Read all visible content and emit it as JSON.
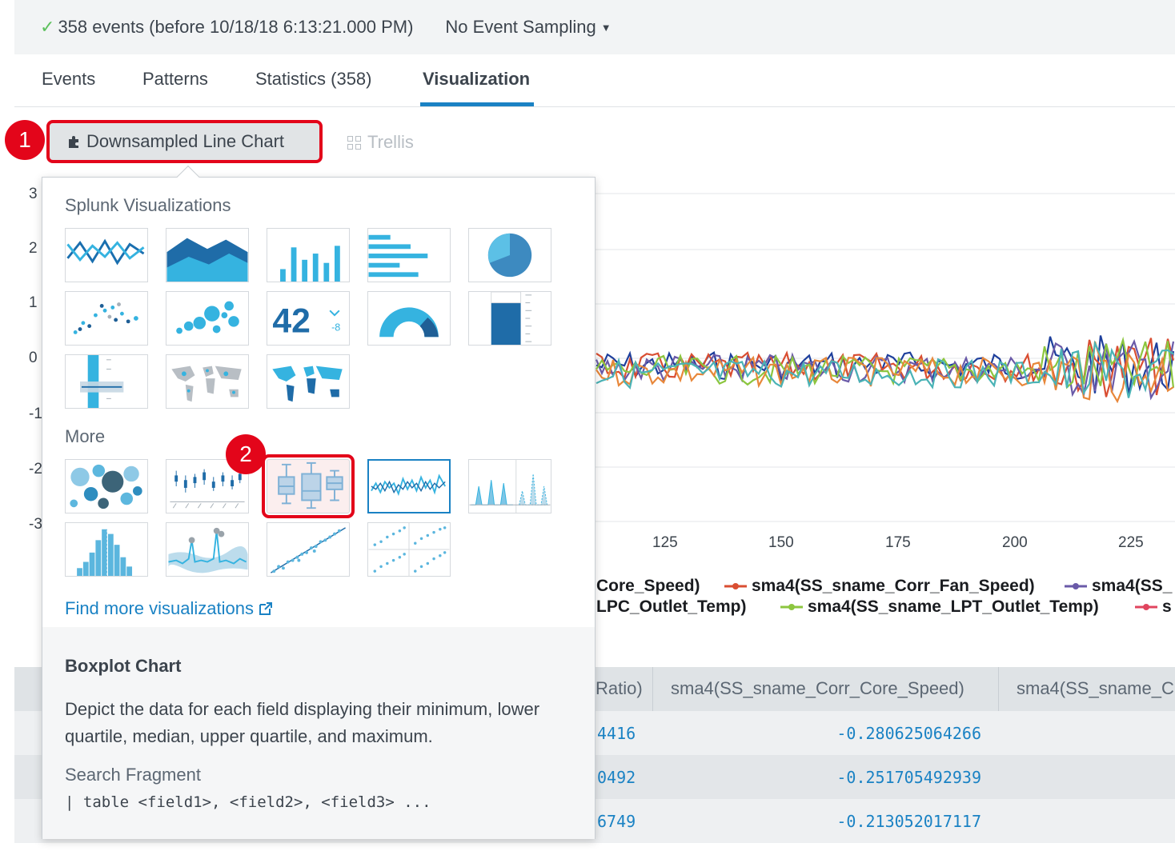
{
  "status": {
    "events_text": "358 events (before 10/18/18 6:13:21.000 PM)",
    "sampling_label": "No Event Sampling"
  },
  "tabs": [
    {
      "label": "Events"
    },
    {
      "label": "Patterns"
    },
    {
      "label": "Statistics (358)"
    },
    {
      "label": "Visualization",
      "active": true
    }
  ],
  "toolbar": {
    "viz_label": "Downsampled Line Chart",
    "trellis_label": "Trellis"
  },
  "callouts": [
    "1",
    "2"
  ],
  "chart": {
    "x_ticks": [
      "125",
      "150",
      "175",
      "200",
      "225"
    ],
    "y_ticks_clipped": [
      "3",
      "2",
      "1",
      "0",
      "-1",
      "-2",
      "-3"
    ],
    "legend_row1": [
      "Core_Speed)",
      "sma4(SS_sname_Corr_Fan_Speed)",
      "sma4(SS_"
    ],
    "legend_row2": [
      "LPC_Outlet_Temp)",
      "sma4(SS_sname_LPT_Outlet_Temp)",
      "s"
    ],
    "series_colors": [
      "#1e3f9c",
      "#d94e32",
      "#6a5aa8",
      "#8cc63f",
      "#e8873a",
      "#4ab3b6"
    ]
  },
  "table": {
    "headers": [
      "Ratio)",
      "sma4(SS_sname_Corr_Core_Speed)",
      "sma4(SS_sname_C"
    ],
    "rows": [
      [
        "4416",
        "-0.280625064266"
      ],
      [
        "0492",
        "-0.251705492939"
      ],
      [
        "6749",
        "-0.213052017117"
      ]
    ]
  },
  "popover": {
    "section_splunk": "Splunk Visualizations",
    "section_more": "More",
    "splunk_tiles": [
      "line-chart-icon",
      "area-chart-icon",
      "column-chart-icon",
      "bar-chart-icon",
      "pie-chart-icon",
      "scatter-chart-icon",
      "bubble-chart-icon",
      "single-value-icon",
      "radial-gauge-icon",
      "filler-gauge-icon",
      "marker-gauge-icon",
      "cluster-map-icon",
      "choropleth-map-icon"
    ],
    "single_value_number": "42",
    "single_value_delta": "-8",
    "more_tiles": [
      "bubble-chart-more-icon",
      "candlestick-chart-icon",
      "boxplot-chart-icon",
      "downsampled-line-chart-icon",
      "horizon-chart-icon",
      "histogram-chart-icon",
      "outliers-chart-icon",
      "scatterline-chart-icon",
      "scatterplot-matrix-icon"
    ],
    "find_more_label": "Find more visualizations",
    "description": {
      "title": "Boxplot Chart",
      "text": "Depict the data for each field displaying their minimum, lower quartile, median, upper quartile, and maximum.",
      "fragment_title": "Search Fragment",
      "fragment_code": "| table <field1>, <field2>, <field3> ..."
    }
  }
}
